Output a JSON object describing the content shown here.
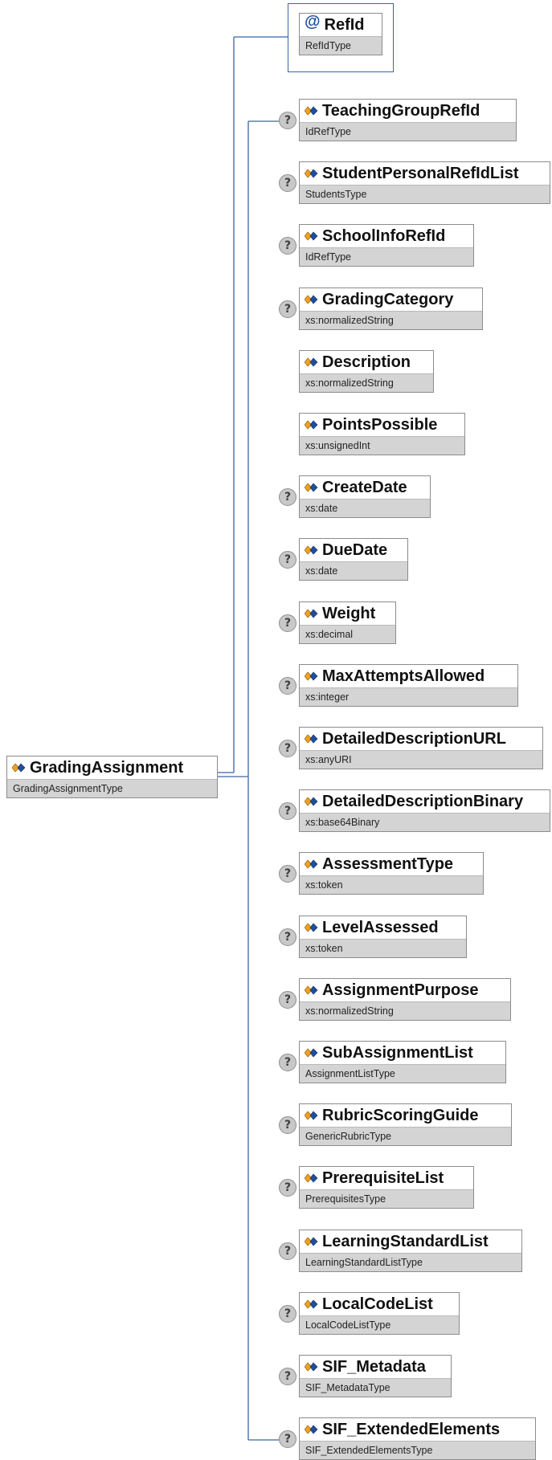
{
  "root": {
    "name": "GradingAssignment",
    "type": "GradingAssignmentType",
    "icon": "element-icon"
  },
  "attribute": {
    "symbol": "@",
    "name": "RefId",
    "type": "RefIdType",
    "icon": "attribute-icon"
  },
  "children": [
    {
      "name": "TeachingGroupRefId",
      "type": "IdRefType",
      "optional": true
    },
    {
      "name": "StudentPersonalRefIdList",
      "type": "StudentsType",
      "optional": true
    },
    {
      "name": "SchoolInfoRefId",
      "type": "IdRefType",
      "optional": true
    },
    {
      "name": "GradingCategory",
      "type": "xs:normalizedString",
      "optional": true
    },
    {
      "name": "Description",
      "type": "xs:normalizedString",
      "optional": false
    },
    {
      "name": "PointsPossible",
      "type": "xs:unsignedInt",
      "optional": false
    },
    {
      "name": "CreateDate",
      "type": "xs:date",
      "optional": true
    },
    {
      "name": "DueDate",
      "type": "xs:date",
      "optional": true
    },
    {
      "name": "Weight",
      "type": "xs:decimal",
      "optional": true
    },
    {
      "name": "MaxAttemptsAllowed",
      "type": "xs:integer",
      "optional": true
    },
    {
      "name": "DetailedDescriptionURL",
      "type": "xs:anyURI",
      "optional": true
    },
    {
      "name": "DetailedDescriptionBinary",
      "type": "xs:base64Binary",
      "optional": true
    },
    {
      "name": "AssessmentType",
      "type": "xs:token",
      "optional": true
    },
    {
      "name": "LevelAssessed",
      "type": "xs:token",
      "optional": true
    },
    {
      "name": "AssignmentPurpose",
      "type": "xs:normalizedString",
      "optional": true
    },
    {
      "name": "SubAssignmentList",
      "type": "AssignmentListType",
      "optional": true
    },
    {
      "name": "RubricScoringGuide",
      "type": "GenericRubricType",
      "optional": true
    },
    {
      "name": "PrerequisiteList",
      "type": "PrerequisitesType",
      "optional": true
    },
    {
      "name": "LearningStandardList",
      "type": "LearningStandardListType",
      "optional": true
    },
    {
      "name": "LocalCodeList",
      "type": "LocalCodeListType",
      "optional": true
    },
    {
      "name": "SIF_Metadata",
      "type": "SIF_MetadataType",
      "optional": true
    },
    {
      "name": "SIF_ExtendedElements",
      "type": "SIF_ExtendedElementsType",
      "optional": true
    }
  ],
  "optional_symbol": "?",
  "colors": {
    "connector": "#3a65a8",
    "type_band": "#d4d4d4",
    "border": "#8c8c8c",
    "icon_orange": "#f0a020",
    "icon_blue": "#1f4f9a"
  }
}
